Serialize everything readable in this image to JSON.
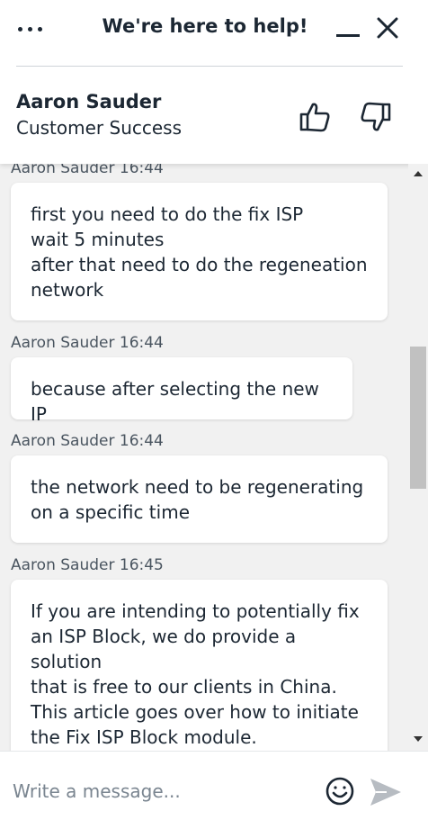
{
  "header": {
    "title": "We're here to help!",
    "agent_name": "Aaron Sauder",
    "agent_role": "Customer Success"
  },
  "messages": [
    {
      "author": "Aaron Sauder",
      "time": "16:44",
      "text": "first you need to do the fix ISP\nwait 5 minutes\nafter that need to do the regeneation\nnetwork"
    },
    {
      "author": "Aaron Sauder",
      "time": "16:44",
      "text": "because after selecting the new IP"
    },
    {
      "author": "Aaron Sauder",
      "time": "16:44",
      "text": "the network need to be regenerating\non a specific time"
    },
    {
      "author": "Aaron Sauder",
      "time": "16:45",
      "text": "If you are intending to potentially fix\nan ISP Block, we do provide a solution\nthat is free to our clients in China.\nThis article goes over how to initiate\nthe Fix ISP Block module. Additionally,\nit offers instructions in Chinese and"
    }
  ],
  "composer": {
    "placeholder": "Write a message..."
  },
  "colors": {
    "text": "#1c2733",
    "chat_background": "#f1f1f1",
    "bubble": "#ffffff",
    "send_icon": "#b7bcc2"
  },
  "icons": [
    "more-icon",
    "minimize-icon",
    "close-icon",
    "thumbs-up-icon",
    "thumbs-down-icon",
    "emoji-icon",
    "send-icon"
  ]
}
